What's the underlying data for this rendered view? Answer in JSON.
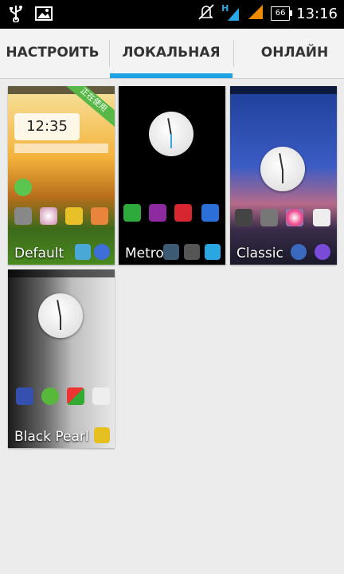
{
  "status_bar": {
    "time": "13:16",
    "battery": "66",
    "network": "H",
    "icons": [
      "usb-icon",
      "image-icon",
      "mute-icon",
      "signal-icon",
      "battery-icon"
    ]
  },
  "tabs": [
    {
      "label": "НАСТРОИТЬ",
      "active": false
    },
    {
      "label": "ЛОКАЛЬНАЯ",
      "active": true
    },
    {
      "label": "ОНЛАЙН",
      "active": false
    }
  ],
  "themes": [
    {
      "name": "Default",
      "badge": "正在使用",
      "clock": "12:35"
    },
    {
      "name": "Metro"
    },
    {
      "name": "Classic"
    },
    {
      "name": "Black Pearl"
    }
  ],
  "colors": {
    "accent": "#1fa2e4",
    "background": "#ececec",
    "badge": "#57b847"
  }
}
